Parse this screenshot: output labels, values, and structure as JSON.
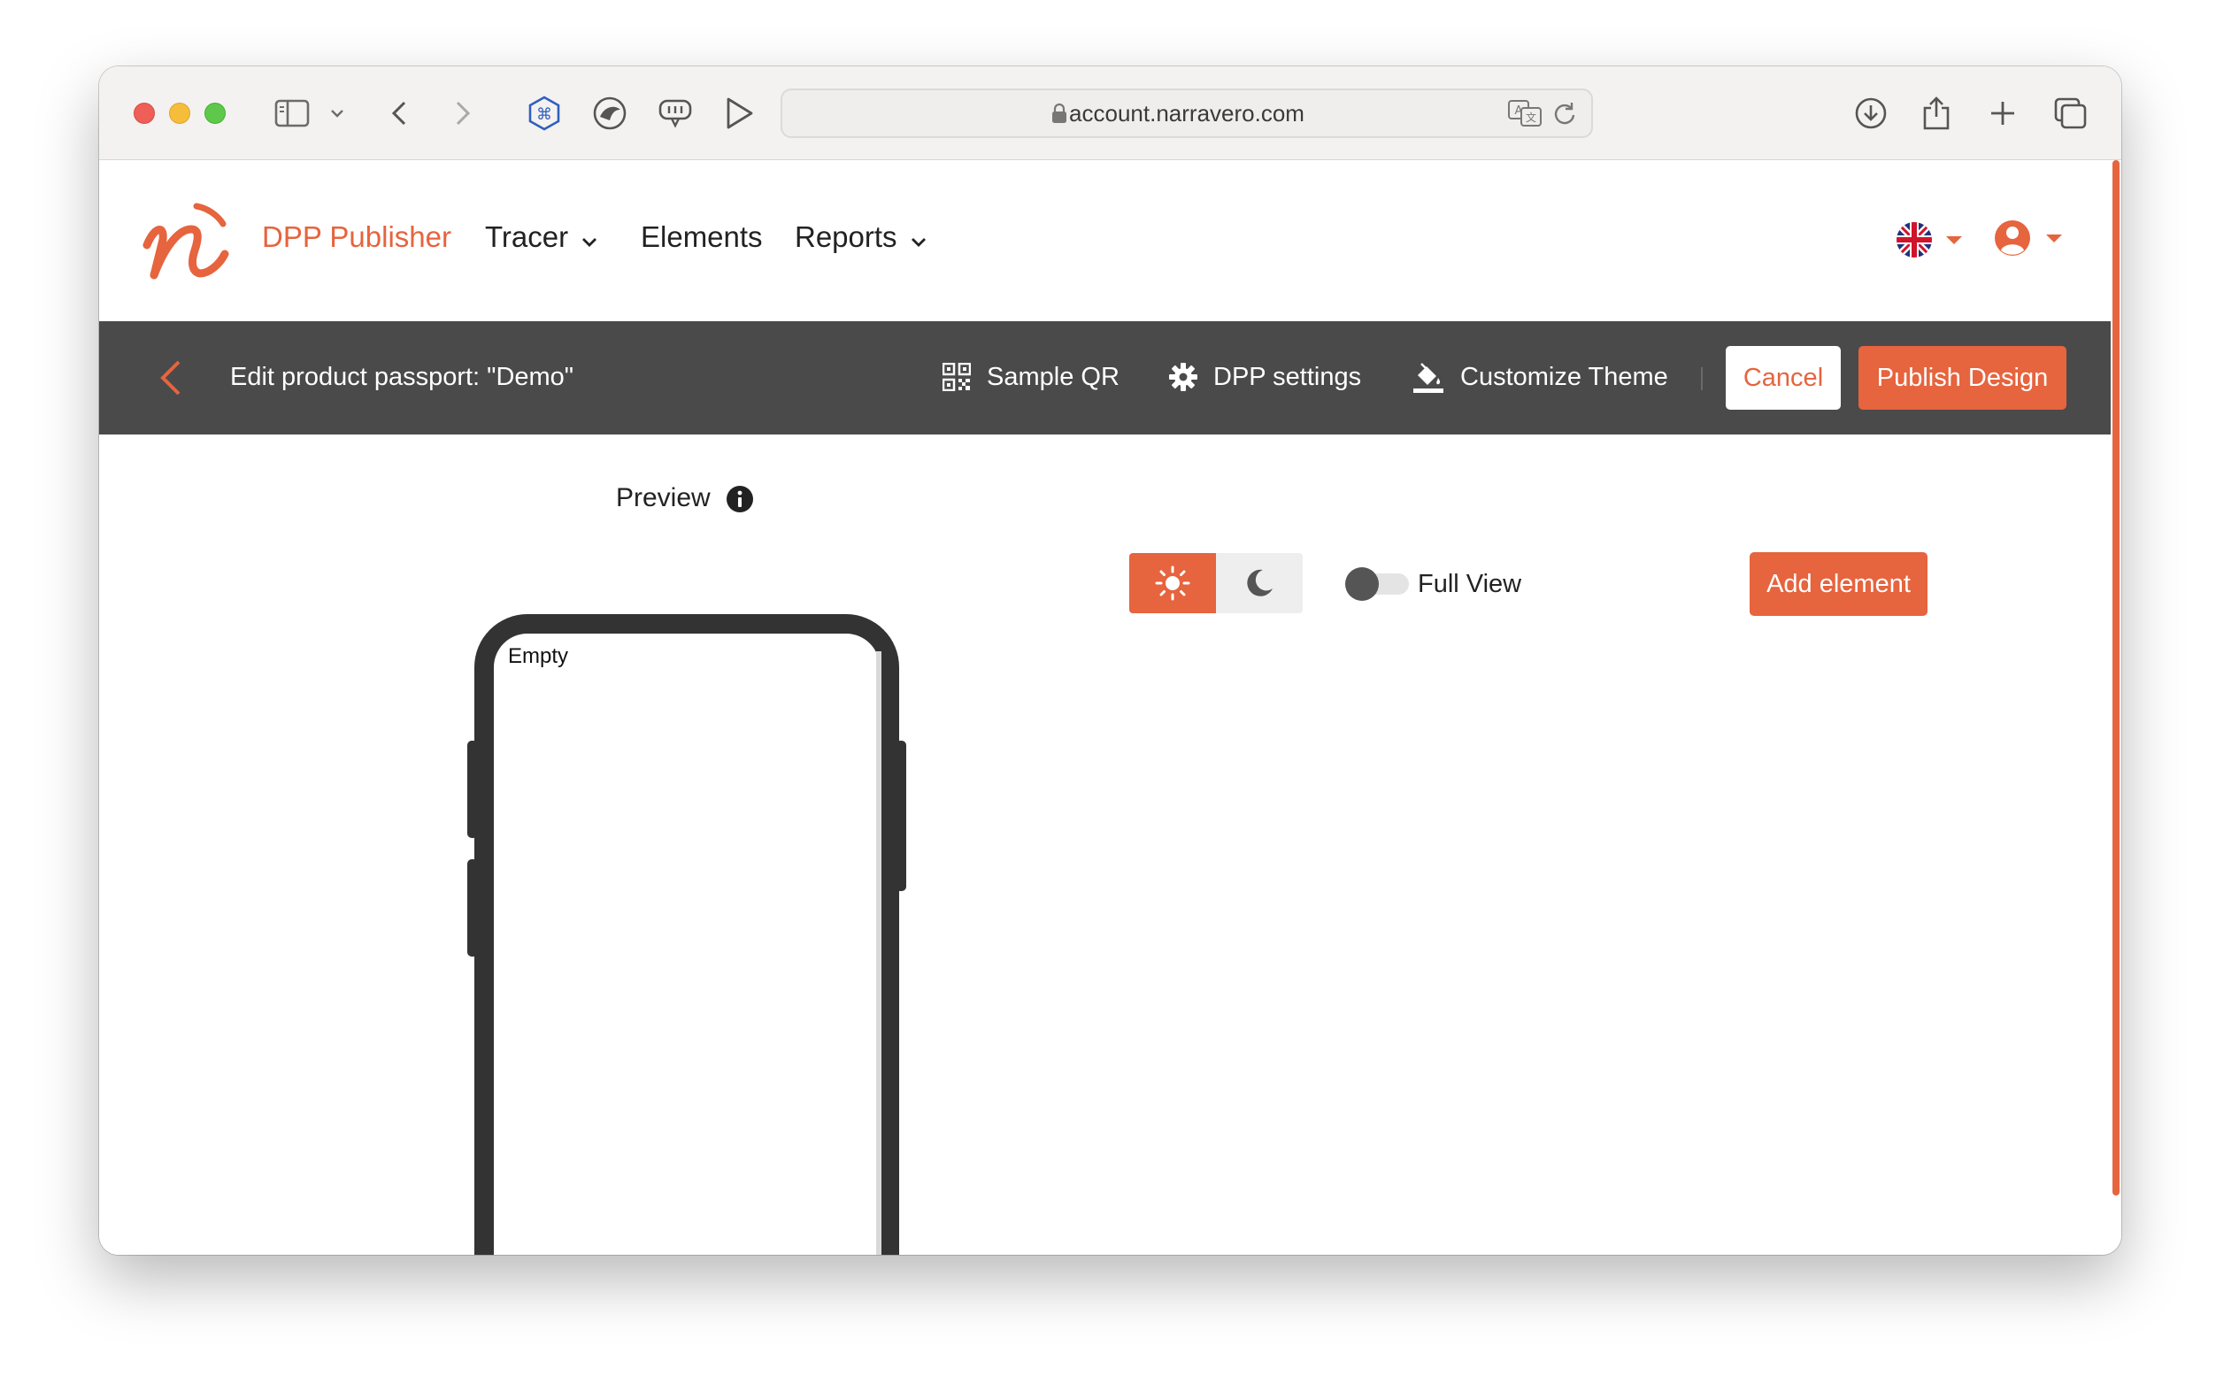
{
  "browser": {
    "url": "account.narravero.com",
    "icons": [
      "sidebar-icon",
      "chevron-down-icon",
      "back-icon",
      "forward-icon",
      "extension-command-icon",
      "extension-bird-icon",
      "extension-chat-icon",
      "play-icon",
      "lock-icon",
      "translate-icon",
      "reload-icon",
      "download-icon",
      "share-icon",
      "new-tab-icon",
      "tabs-overview-icon"
    ]
  },
  "nav": {
    "brand": "DPP Publisher",
    "items": [
      {
        "label": "Tracer",
        "has_dropdown": true
      },
      {
        "label": "Elements",
        "has_dropdown": false
      },
      {
        "label": "Reports",
        "has_dropdown": true
      }
    ],
    "language_icon": "uk-flag-icon",
    "account_icon": "user-circle-icon"
  },
  "editbar": {
    "title": "Edit product passport: \"Demo\"",
    "sample_qr": "Sample QR",
    "dpp_settings": "DPP settings",
    "customize_theme": "Customize Theme",
    "cancel": "Cancel",
    "publish": "Publish Design"
  },
  "preview": {
    "label": "Preview",
    "empty_text": "Empty"
  },
  "controls": {
    "mode_selected": "light",
    "full_view_label": "Full View",
    "full_view_on": false,
    "add_element": "Add element"
  },
  "colors": {
    "accent": "#e6643e",
    "editbar_bg": "#4a4a4a",
    "phone_frame": "#333333"
  }
}
